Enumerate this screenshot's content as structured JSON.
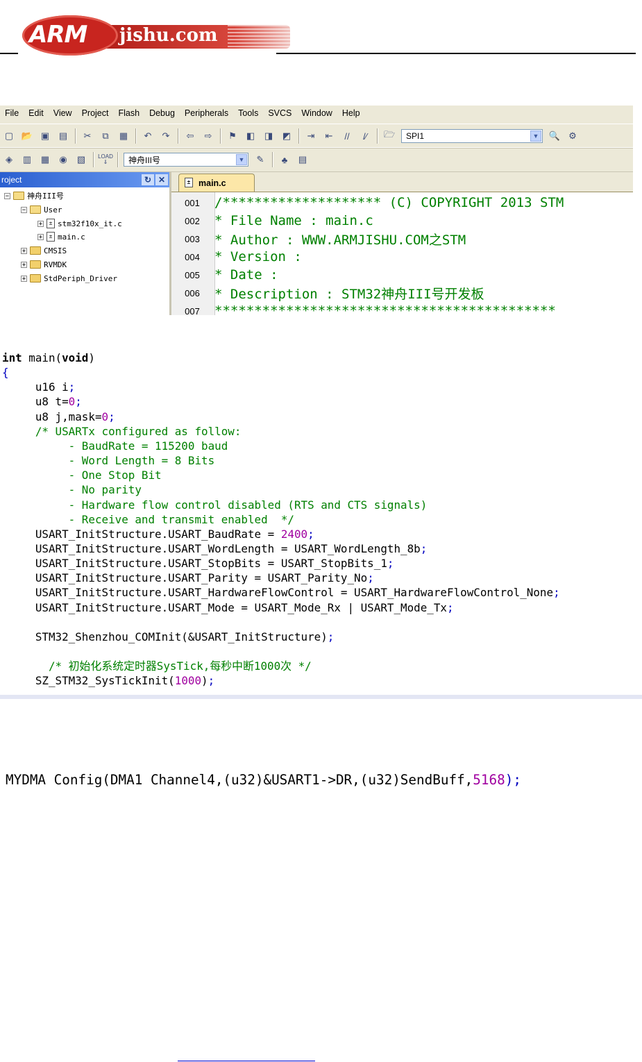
{
  "header": {
    "logo_arm": "ARM",
    "logo_domain": "jishu.com"
  },
  "ide": {
    "menu": [
      "File",
      "Edit",
      "View",
      "Project",
      "Flash",
      "Debug",
      "Peripherals",
      "Tools",
      "SVCS",
      "Window",
      "Help"
    ],
    "toolbar1_combo": "SPI1",
    "toolbar2_load": "LOAD",
    "toolbar2_combo": "神舟III号",
    "project_title": "roject",
    "tree": [
      {
        "label": "神舟III号",
        "level": 0,
        "type": "folder-open",
        "expander": "−"
      },
      {
        "label": "User",
        "level": 1,
        "type": "folder-open",
        "expander": "−"
      },
      {
        "label": "stm32f10x_it.c",
        "level": 2,
        "type": "file",
        "expander": "+"
      },
      {
        "label": "main.c",
        "level": 2,
        "type": "file",
        "expander": "+"
      },
      {
        "label": "CMSIS",
        "level": 1,
        "type": "folder",
        "expander": "+"
      },
      {
        "label": "RVMDK",
        "level": 1,
        "type": "folder",
        "expander": "+"
      },
      {
        "label": "StdPeriph_Driver",
        "level": 1,
        "type": "folder",
        "expander": "+"
      }
    ],
    "tab_label": "main.c",
    "code_lines": [
      {
        "num": "001",
        "text": "/******************** (C) COPYRIGHT 2013 STM"
      },
      {
        "num": "002",
        "text": "* File Name          : main.c"
      },
      {
        "num": "003",
        "text": "* Author             : WWW.ARMJISHU.COM之STM"
      },
      {
        "num": "004",
        "text": "* Version            :"
      },
      {
        "num": "005",
        "text": "* Date               :"
      },
      {
        "num": "006",
        "text": "* Description        : STM32神舟III号开发板"
      },
      {
        "num": "007",
        "text": "*******************************************"
      }
    ]
  },
  "snippet": {
    "lines": [
      [
        {
          "t": "int",
          "c": "kw"
        },
        {
          "t": " main(",
          "c": ""
        },
        {
          "t": "void",
          "c": "kw"
        },
        {
          "t": ")",
          "c": ""
        }
      ],
      [
        {
          "t": "{",
          "c": "op"
        }
      ],
      [
        {
          "t": "     u16 i",
          "c": ""
        },
        {
          "t": ";",
          "c": "op"
        }
      ],
      [
        {
          "t": "     u8 t=",
          "c": ""
        },
        {
          "t": "0",
          "c": "nm"
        },
        {
          "t": ";",
          "c": "op"
        }
      ],
      [
        {
          "t": "     u8 j,mask=",
          "c": ""
        },
        {
          "t": "0",
          "c": "nm"
        },
        {
          "t": ";",
          "c": "op"
        }
      ],
      [
        {
          "t": "     /* USARTx configured as follow:",
          "c": "cm"
        }
      ],
      [
        {
          "t": "          - BaudRate = 115200 baud",
          "c": "cm"
        }
      ],
      [
        {
          "t": "          - Word Length = 8 Bits",
          "c": "cm"
        }
      ],
      [
        {
          "t": "          - One Stop Bit",
          "c": "cm"
        }
      ],
      [
        {
          "t": "          - No parity",
          "c": "cm"
        }
      ],
      [
        {
          "t": "          - Hardware flow control disabled (RTS and CTS signals)",
          "c": "cm"
        }
      ],
      [
        {
          "t": "          - Receive and transmit enabled  */",
          "c": "cm"
        }
      ],
      [
        {
          "t": "     USART_InitStructure.USART_BaudRate = ",
          "c": ""
        },
        {
          "t": "2400",
          "c": "nm"
        },
        {
          "t": ";",
          "c": "op"
        }
      ],
      [
        {
          "t": "     USART_InitStructure.USART_WordLength = USART_WordLength_8b",
          "c": ""
        },
        {
          "t": ";",
          "c": "op"
        }
      ],
      [
        {
          "t": "     USART_InitStructure.USART_StopBits = USART_StopBits_1",
          "c": ""
        },
        {
          "t": ";",
          "c": "op"
        }
      ],
      [
        {
          "t": "     USART_InitStructure.USART_Parity = USART_Parity_No",
          "c": ""
        },
        {
          "t": ";",
          "c": "op"
        }
      ],
      [
        {
          "t": "     USART_InitStructure.USART_HardwareFlowControl = USART_HardwareFlowControl_None",
          "c": ""
        },
        {
          "t": ";",
          "c": "op"
        }
      ],
      [
        {
          "t": "     USART_InitStructure.USART_Mode = USART_Mode_Rx | USART_Mode_Tx",
          "c": ""
        },
        {
          "t": ";",
          "c": "op"
        }
      ],
      [
        {
          "t": "",
          "c": ""
        }
      ],
      [
        {
          "t": "     STM32_Shenzhou_COMInit(&USART_InitStructure)",
          "c": ""
        },
        {
          "t": ";",
          "c": "op"
        }
      ],
      [
        {
          "t": "",
          "c": ""
        }
      ],
      [
        {
          "t": "       /* 初始化系统定时器SysTick,每秒中断1000次 */",
          "c": "cm"
        }
      ],
      [
        {
          "t": "     SZ_STM32_SysTickInit(",
          "c": ""
        },
        {
          "t": "1000",
          "c": "nm"
        },
        {
          "t": ")",
          "c": ""
        },
        {
          "t": ";",
          "c": "op"
        }
      ]
    ]
  },
  "dma_line": [
    {
      "t": "MYDMA Config(DMA1 Channel4,(u32)&USART1->DR,(u32)SendBuff,",
      "c": ""
    },
    {
      "t": "5168",
      "c": "nm"
    },
    {
      "t": ");",
      "c": "op"
    }
  ]
}
